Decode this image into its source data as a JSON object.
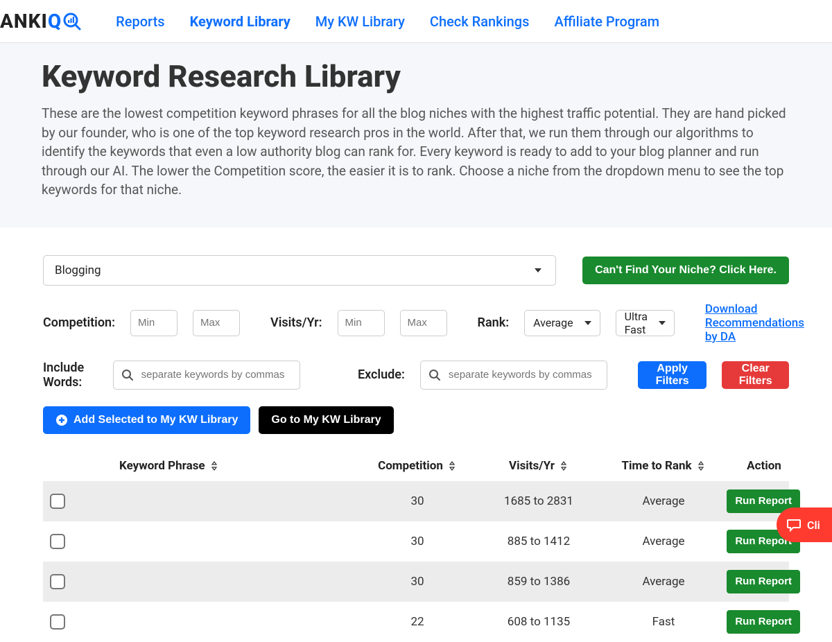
{
  "brand": {
    "name": "ANKI",
    "suffix": "Q"
  },
  "nav": [
    {
      "label": "Reports",
      "active": false
    },
    {
      "label": "Keyword Library",
      "active": true
    },
    {
      "label": "My KW Library",
      "active": false
    },
    {
      "label": "Check Rankings",
      "active": false
    },
    {
      "label": "Affiliate Program",
      "active": false
    }
  ],
  "hero": {
    "title": "Keyword Research Library",
    "desc": "These are the lowest competition keyword phrases for all the blog niches with the highest traffic potential. They are hand picked by our founder, who is one of the top keyword research pros in the world. After that, we run them through our algorithms to identify the keywords that even a low authority blog can rank for. Every keyword is ready to add to your blog planner and run through our AI. The lower the Competition score, the easier it is to rank. Choose a niche from the dropdown menu to see the top keywords for that niche."
  },
  "niche": {
    "selected": "Blogging"
  },
  "cta_niche": "Can't Find Your Niche? Click Here.",
  "filters": {
    "competition_label": "Competition:",
    "visits_label": "Visits/Yr:",
    "rank_label": "Rank:",
    "min_ph": "Min",
    "max_ph": "Max",
    "rank_value": "Average",
    "speed_value": "Ultra Fast",
    "download_link": "Download Recommendations by DA",
    "include_label": "Include Words:",
    "exclude_label": "Exclude:",
    "include_ph": "separate keywords by commas",
    "exclude_ph": "separate keywords by commas",
    "apply": "Apply Filters",
    "clear": "Clear Filters"
  },
  "actions": {
    "add_selected": "Add Selected to My KW Library",
    "go_library": "Go to My KW Library"
  },
  "table": {
    "headers": {
      "phrase": "Keyword Phrase",
      "competition": "Competition",
      "visits": "Visits/Yr",
      "time": "Time to Rank",
      "action": "Action"
    },
    "action_label": "Run Report",
    "rows": [
      {
        "competition": "30",
        "visits": "1685 to 2831",
        "time": "Average"
      },
      {
        "competition": "30",
        "visits": "885 to 1412",
        "time": "Average"
      },
      {
        "competition": "30",
        "visits": "859 to 1386",
        "time": "Average"
      },
      {
        "competition": "22",
        "visits": "608 to 1135",
        "time": "Fast"
      }
    ]
  },
  "chat": {
    "label": "Cli"
  }
}
